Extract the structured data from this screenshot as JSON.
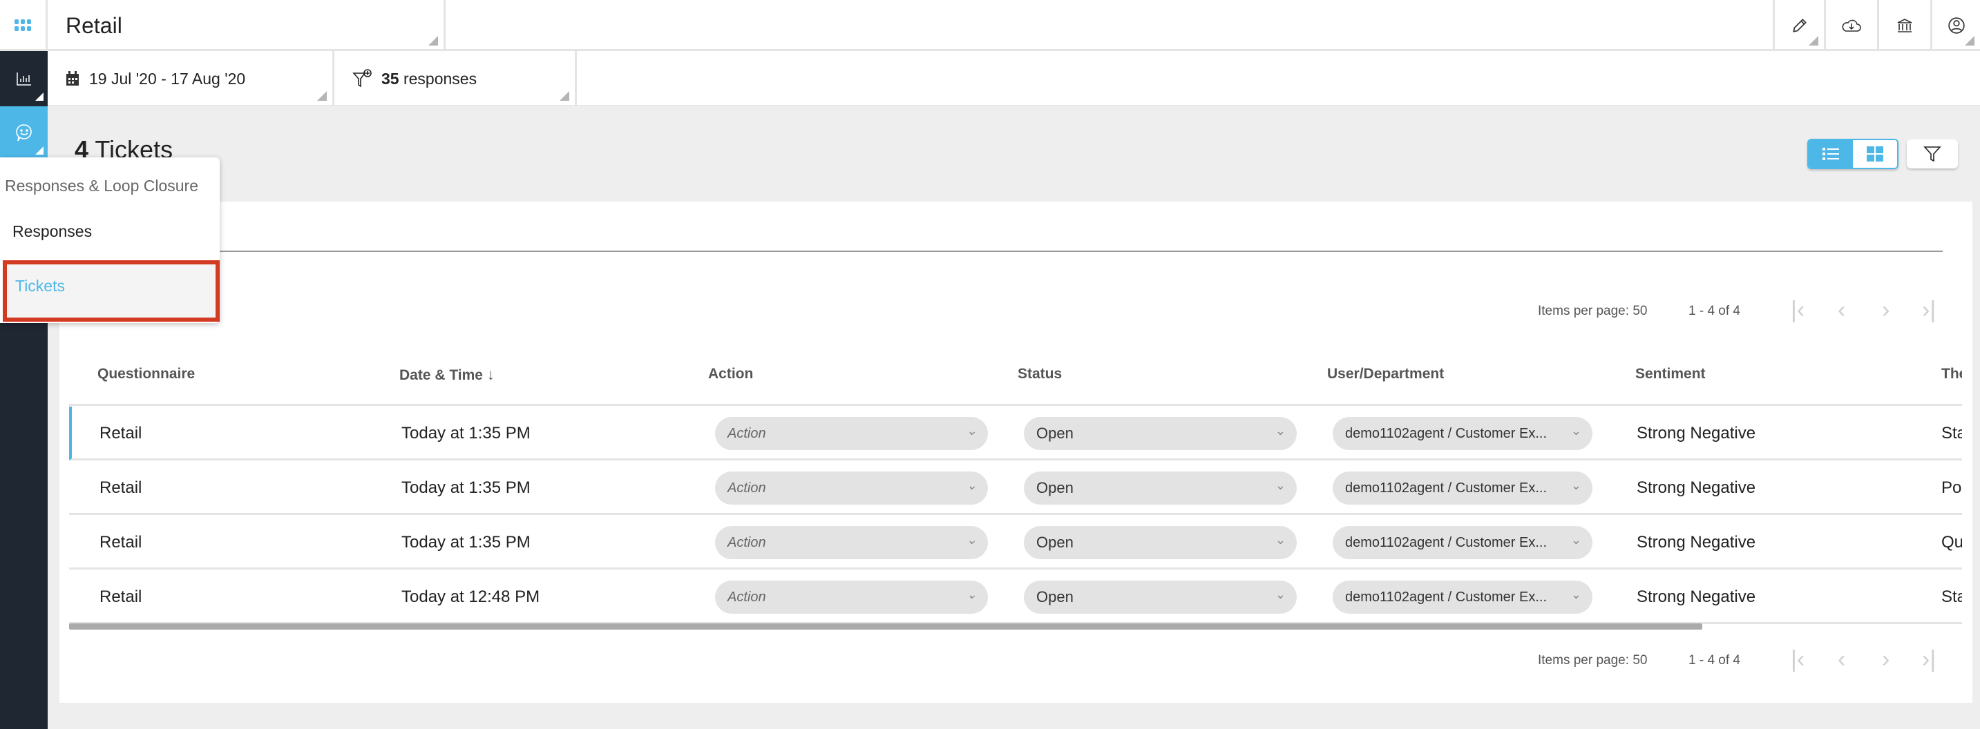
{
  "header": {
    "title": "Retail",
    "icons": [
      "apps-grid-icon",
      "pencil-icon",
      "cloud-download-icon",
      "bank-icon",
      "user-circle-icon"
    ]
  },
  "filters": {
    "date_range": "19 Jul '20 - 17 Aug '20",
    "responses_count": "35",
    "responses_label": "responses"
  },
  "page": {
    "count": "4",
    "title": "Tickets"
  },
  "menu": {
    "heading": "Responses & Loop Closure",
    "items": [
      {
        "label": "Responses"
      },
      {
        "label": "Tickets",
        "active": true
      }
    ]
  },
  "pagination": {
    "items_per_page_label": "Items per page:",
    "items_per_page": "50",
    "range": "1 - 4 of 4"
  },
  "table": {
    "columns": [
      "Questionnaire",
      "Date & Time",
      "Action",
      "Status",
      "User/Department",
      "Sentiment",
      "The"
    ],
    "sort_column": "Date & Time",
    "rows": [
      {
        "questionnaire": "Retail",
        "datetime": "Today at 1:35 PM",
        "action": "Action",
        "status": "Open",
        "user": "demo1102agent / Customer Ex...",
        "sentiment": "Strong Negative",
        "theme": "Sta"
      },
      {
        "questionnaire": "Retail",
        "datetime": "Today at 1:35 PM",
        "action": "Action",
        "status": "Open",
        "user": "demo1102agent / Customer Ex...",
        "sentiment": "Strong Negative",
        "theme": "Poo"
      },
      {
        "questionnaire": "Retail",
        "datetime": "Today at 1:35 PM",
        "action": "Action",
        "status": "Open",
        "user": "demo1102agent / Customer Ex...",
        "sentiment": "Strong Negative",
        "theme": "Qu"
      },
      {
        "questionnaire": "Retail",
        "datetime": "Today at 12:48 PM",
        "action": "Action",
        "status": "Open",
        "user": "demo1102agent / Customer Ex...",
        "sentiment": "Strong Negative",
        "theme": "Sta"
      }
    ]
  },
  "colors": {
    "accent": "#4db8e8",
    "sidebar": "#1f2733",
    "highlight_border": "#d23a22"
  }
}
